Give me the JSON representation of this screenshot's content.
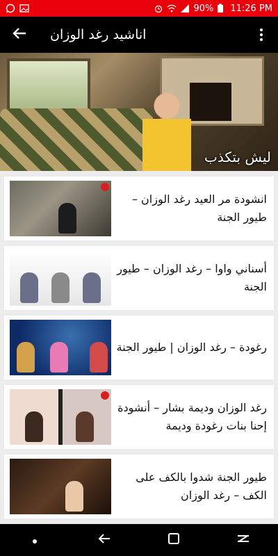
{
  "status_bar": {
    "battery": "90%",
    "time": "11:26 PM",
    "left_icons": [
      "whatsapp-icon",
      "image-icon"
    ],
    "right_icons": [
      "alarm-icon",
      "wifi-icon",
      "signal-icon",
      "battery-icon"
    ]
  },
  "app_bar": {
    "title": "اناشيد رغد الوزان",
    "back_icon": "back-arrow-icon",
    "menu_icon": "more-vert-icon"
  },
  "hero": {
    "caption": "ليش بتكذب"
  },
  "videos": [
    {
      "title": "انشودة مر العيد رغد الوزان –طيور الجنة"
    },
    {
      "title": "أسناني واوا – رغد الوزان – طيور الجنة"
    },
    {
      "title": "رغودة – رغد الوزان | طيور الجنة"
    },
    {
      "title": "رغد الوزان وديمة بشار – أنشودة إحنا بنات رغودة وديمة"
    },
    {
      "title": "طيور الجنة   شدوا بالكف على الكف  – رغد الوزان"
    }
  ],
  "nav_bar": {
    "buttons": [
      "dot-icon",
      "back-icon",
      "recents-icon",
      "home-icon"
    ]
  },
  "colors": {
    "status_bar": "#e8000b",
    "app_bar": "#000000",
    "background": "#ececec"
  }
}
